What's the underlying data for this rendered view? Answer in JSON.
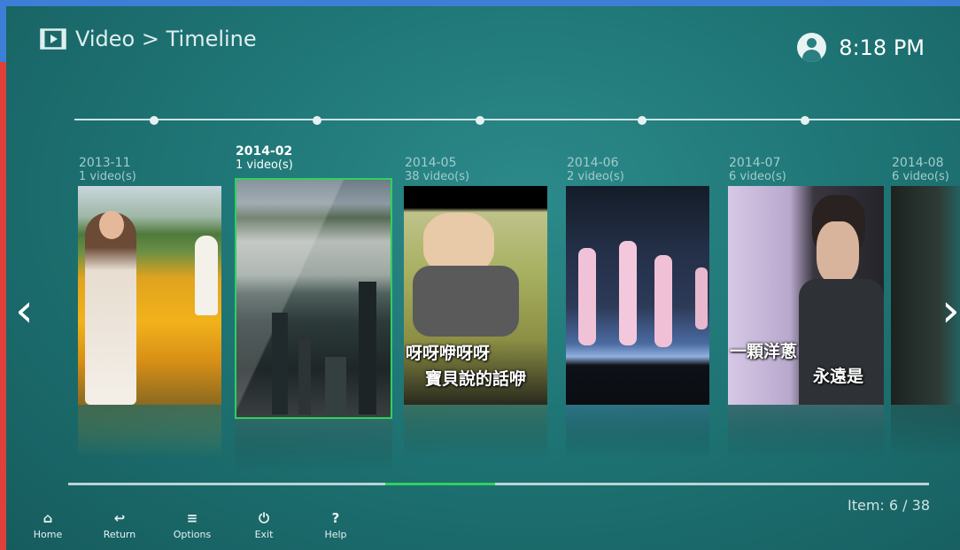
{
  "header": {
    "breadcrumb": "Video > Timeline",
    "time": "8:18 PM"
  },
  "icons": {
    "title": "video-player-icon",
    "user": "user-avatar-icon",
    "prev": "chevron-left-icon",
    "next": "chevron-right-icon"
  },
  "timeline": {
    "selected_index": 1,
    "items": [
      {
        "date": "2013-11",
        "count": "1 video(s)",
        "subtitle_1": "",
        "subtitle_2": ""
      },
      {
        "date": "2014-02",
        "count": "1 video(s)",
        "subtitle_1": "",
        "subtitle_2": ""
      },
      {
        "date": "2014-05",
        "count": "38 video(s)",
        "subtitle_1": "呀呀咿呀呀",
        "subtitle_2": "寶貝說的話咿"
      },
      {
        "date": "2014-06",
        "count": "2 video(s)",
        "subtitle_1": "",
        "subtitle_2": ""
      },
      {
        "date": "2014-07",
        "count": "6 video(s)",
        "subtitle_1": "一顆洋蔥",
        "subtitle_2": "永遠是"
      },
      {
        "date": "2014-08",
        "count": "6 video(s)",
        "subtitle_1": "",
        "subtitle_2": ""
      }
    ]
  },
  "scroll": {
    "position_fraction": 0.37
  },
  "footer": {
    "buttons": [
      {
        "label": "Home",
        "icon": "home-icon",
        "glyph": "⌂"
      },
      {
        "label": "Return",
        "icon": "return-icon",
        "glyph": "↩"
      },
      {
        "label": "Options",
        "icon": "options-icon",
        "glyph": "≡"
      },
      {
        "label": "Exit",
        "icon": "power-icon",
        "glyph": "⏻"
      },
      {
        "label": "Help",
        "icon": "help-icon",
        "glyph": "?"
      }
    ],
    "item_counter": "Item: 6 / 38"
  },
  "colors": {
    "accent_selected": "#2fd15c",
    "background": "#1f7575"
  }
}
